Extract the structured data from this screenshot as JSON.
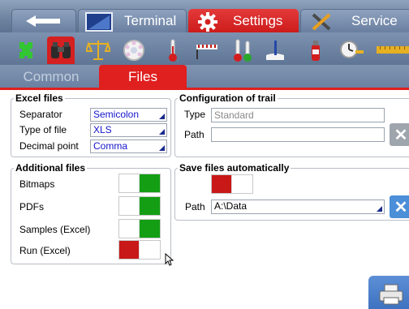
{
  "top_tabs": {
    "terminal": "Terminal",
    "settings": "Settings",
    "service": "Service"
  },
  "icons": [
    "puzzle-icon",
    "binoculars-icon",
    "scale-icon",
    "disk-icon",
    "thermometer-icon",
    "ruler-icon",
    "thermometer-pair-icon",
    "hand-icon",
    "extinguisher-icon",
    "clock-icon",
    "tape-icon"
  ],
  "sub_tabs": {
    "common": "Common",
    "files": "Files"
  },
  "excel_files": {
    "title": "Excel files",
    "separator_label": "Separator",
    "separator_value": "Semicolon",
    "type_label": "Type of file",
    "type_value": "XLS",
    "decimal_label": "Decimal point",
    "decimal_value": "Comma"
  },
  "trail": {
    "title": "Configuration of trail",
    "type_label": "Type",
    "type_value": "Standard",
    "path_label": "Path",
    "path_value": ""
  },
  "additional": {
    "title": "Additional files",
    "items": [
      {
        "label": "Bitmaps",
        "state": "on"
      },
      {
        "label": "PDFs",
        "state": "on"
      },
      {
        "label": "Samples (Excel)",
        "state": "on"
      },
      {
        "label": "Run (Excel)",
        "state": "off"
      }
    ]
  },
  "save_auto": {
    "title": "Save files automatically",
    "state": "off",
    "path_label": "Path",
    "path_value": "A:\\Data"
  },
  "colors": {
    "active_red": "#e01f1f",
    "toggle_on": "#149e14",
    "toggle_off": "#c81818",
    "bar_blue": "#6d829f"
  }
}
